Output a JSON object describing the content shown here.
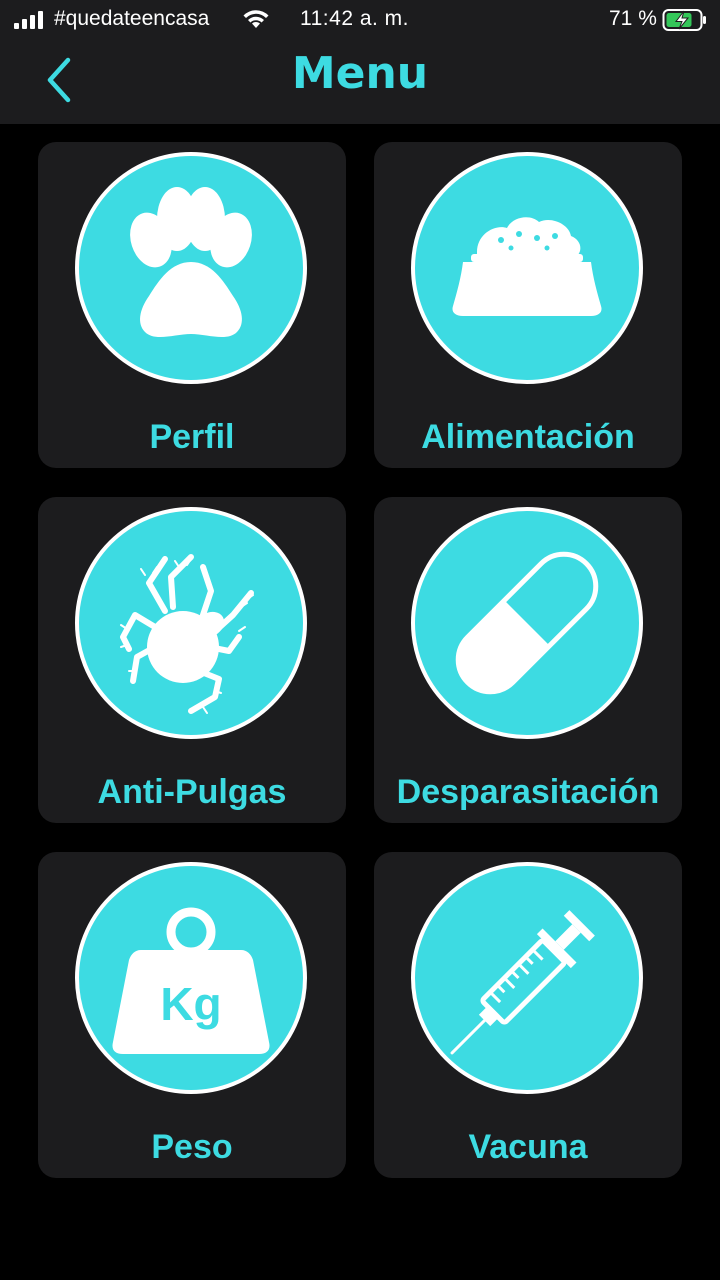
{
  "status_bar": {
    "carrier": "#quedateencasa",
    "time": "11:42 a. m.",
    "battery": "71 %"
  },
  "nav": {
    "back_icon": "chevron-left-icon",
    "title": "Menu"
  },
  "colors": {
    "accent": "#3ddbe2",
    "tile_bg": "#1c1c1e",
    "background": "#000000",
    "battery_green": "#34c759"
  },
  "menu": {
    "items": [
      {
        "label": "Perfil",
        "icon": "paw-icon"
      },
      {
        "label": "Alimentación",
        "icon": "food-bowl-icon"
      },
      {
        "label": "Anti-Pulgas",
        "icon": "flea-icon"
      },
      {
        "label": "Desparasitación",
        "icon": "pill-icon"
      },
      {
        "label": "Peso",
        "icon": "weight-icon",
        "icon_text": "Kg"
      },
      {
        "label": "Vacuna",
        "icon": "syringe-icon"
      }
    ]
  }
}
